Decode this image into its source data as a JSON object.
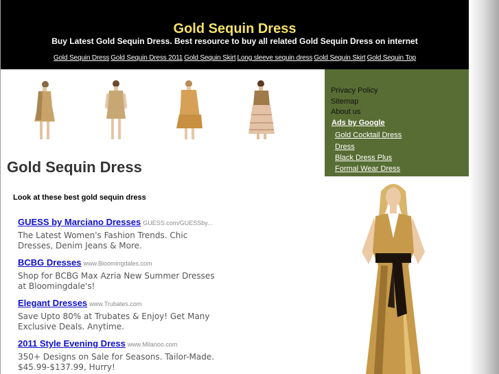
{
  "header": {
    "title": "Gold Sequin Dress",
    "tagline": "Buy Latest Gold Sequin Dress. Best resource to buy all related Gold Sequin Dress on internet",
    "links": [
      "Gold Sequin Dress",
      "Gold Sequin Dress 2011",
      "Gold Sequin Skirt",
      "Long sleeve sequin dress",
      "Gold Sequin Skirt",
      "Gold Sequin Top"
    ]
  },
  "main": {
    "heading": "Gold Sequin Dress",
    "subheading": "Look at these best gold sequin dress",
    "ads": [
      {
        "title": "GUESS by Marciano Dresses",
        "url": "GUESS.com/GUESSby...",
        "desc": "The Latest Women's Fashion Trends. Chic Dresses, Denim Jeans & More."
      },
      {
        "title": "BCBG Dresses",
        "url": "www.Bloomingdales.com",
        "desc": "Shop for BCBG Max Azria New Summer Dresses at Bloomingdale's!"
      },
      {
        "title": "Elegant Dresses",
        "url": "www.Trubates.com",
        "desc": "Save Upto 80% at Trubates & Enjoy! Get Many Exclusive Deals. Anytime."
      },
      {
        "title": "2011 Style Evening Dress",
        "url": "www.Milanoo.com",
        "desc": "350+ Designs on Sale for Seasons. Tailor-Made. $45.99-$137.99, Hurry!"
      }
    ]
  },
  "sidebar": {
    "links": [
      "Privacy Policy",
      "Sitemap",
      "About us"
    ],
    "ads_label": "Ads by Google",
    "ad_links": [
      "Gold Cocktail Dress",
      "Dress",
      "Black Dress Plus",
      "Formal Wear Dress"
    ]
  },
  "colors": {
    "header_bg": "#000000",
    "title": "#f5e16a",
    "sidebar_bg": "#586d34",
    "ad_link": "#1010cc"
  }
}
